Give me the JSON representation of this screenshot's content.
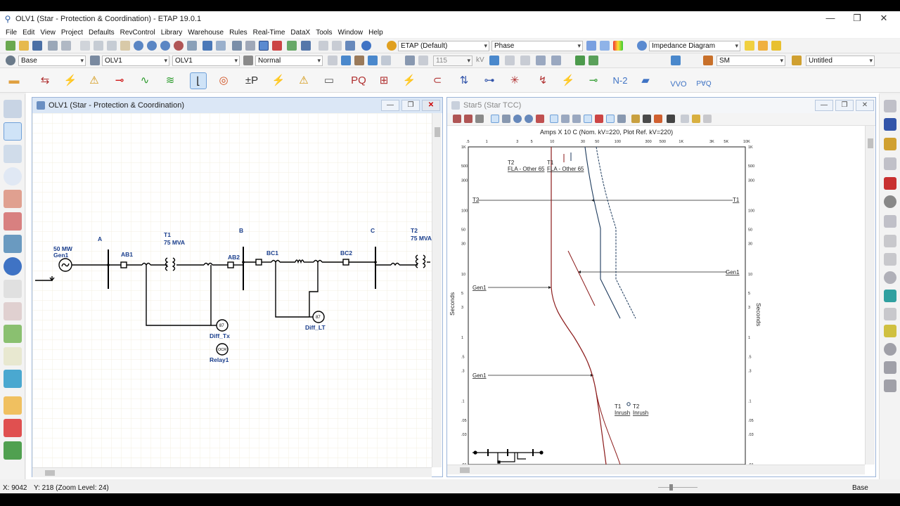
{
  "window": {
    "title": "OLV1 (Star - Protection & Coordination) - ETAP 19.0.1",
    "minimize": "—",
    "maximize": "❐",
    "close": "✕"
  },
  "menu": [
    "File",
    "Edit",
    "View",
    "Project",
    "Defaults",
    "RevControl",
    "Library",
    "Warehouse",
    "Rules",
    "Real-Time",
    "DataX",
    "Tools",
    "Window",
    "Help"
  ],
  "toolbar": {
    "study_case": "ETAP (Default)",
    "phase": "Phase",
    "diagram": "Impedance Diagram",
    "presentation": "Base",
    "olv": "OLV1",
    "olv2": "OLV1",
    "mode": "Normal",
    "kv_value": "115",
    "kv_unit": "kV",
    "sm": "SM",
    "untitled": "Untitled",
    "n2": "N-2",
    "vvo": "VVO",
    "pvq": "P∀Q"
  },
  "olv_window": {
    "title": "OLV1 (Star - Protection & Coordination)",
    "buses": {
      "a": "A",
      "b": "B",
      "c": "C"
    },
    "gen_rating": "50 MW",
    "gen_name": "Gen1",
    "ab1": "AB1",
    "ab2": "AB2",
    "t1_name": "T1",
    "t1_rating": "75 MVA",
    "t2_name": "T2",
    "t2_rating": "75 MVA",
    "bc1": "BC1",
    "bc2": "BC2",
    "relay87_symbol": "87",
    "relay87_symbol2": "87",
    "diff_tx": "Diff_Tx",
    "diff_lt": "Diff_LT",
    "ocr_symbol": "OCR",
    "relay1": "Relay1"
  },
  "tcc_window": {
    "title": "Star5 (Star TCC)",
    "header": "Amps  X 10  C (Nom. kV=220, Plot Ref. kV=220)",
    "x_ticks": [
      ".5",
      "1",
      "3",
      "5",
      "10",
      "30",
      "50",
      "100",
      "300",
      "500",
      "1K",
      "3K",
      "5K",
      "10K"
    ],
    "y_ticks": [
      "1K",
      "500",
      "300",
      "100",
      "50",
      "30",
      "10",
      "5",
      "3",
      "1",
      ".5",
      ".3",
      ".1",
      ".05",
      ".03",
      ".01"
    ],
    "y_label": "Seconds",
    "labels": {
      "t2_fla_name": "T2",
      "t2_fla": "FLA - Other 65",
      "t1_fla_name": "T1",
      "t1_fla": "FLA - Other 65",
      "t2_left": "T2",
      "t1_right": "T1",
      "gen1_a": "Gen1",
      "gen1_b": "Gen1",
      "gen1_c": "Gen1",
      "t1_inrush_name": "T1",
      "t1_inrush": "Inrush",
      "t2_inrush_name": "T2",
      "t2_inrush": "Inrush"
    }
  },
  "status": {
    "x": "X: 9042",
    "y": "Y: 218 (Zoom Level: 24)",
    "presentation": "Base"
  },
  "colors": {
    "accent": "#1a3e8c",
    "wire": "#000000",
    "label_blue": "#1a3e8c",
    "curve_red": "#8b1a1a",
    "curve_navy": "#1c3a5c"
  }
}
